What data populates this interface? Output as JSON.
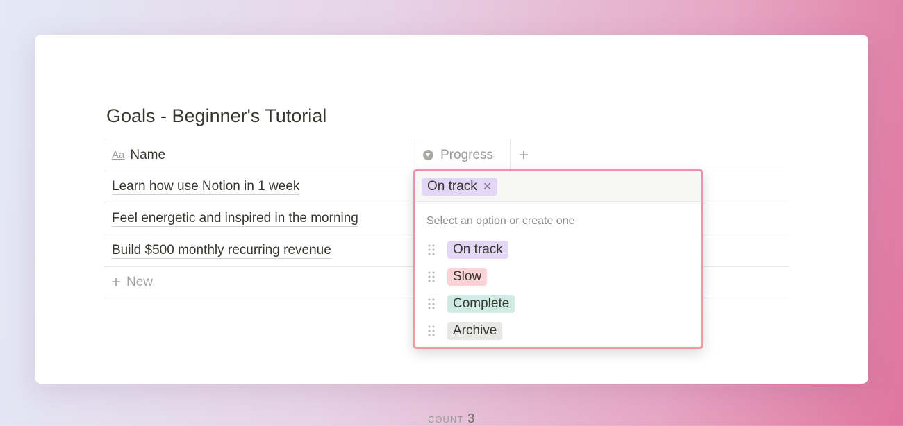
{
  "page": {
    "title": "Goals - Beginner's Tutorial"
  },
  "table": {
    "columns": [
      {
        "label": "Name",
        "icon": "text-icon",
        "icon_text": "Aa"
      },
      {
        "label": "Progress",
        "icon": "select-icon"
      }
    ],
    "add_column": "+",
    "rows": [
      {
        "name": "Learn how use Notion in 1 week"
      },
      {
        "name": "Feel energetic and inspired in the morning"
      },
      {
        "name": "Build $500 monthly recurring revenue"
      }
    ],
    "new_label": "New",
    "count_label": "COUNT",
    "count_value": "3"
  },
  "dropdown": {
    "selected": {
      "label": "On track",
      "color": "#e3d7f5"
    },
    "hint": "Select an option or create one",
    "options": [
      {
        "label": "On track",
        "color": "#e3d7f5"
      },
      {
        "label": "Slow",
        "color": "#fbd3d6"
      },
      {
        "label": "Complete",
        "color": "#d0ebe4"
      },
      {
        "label": "Archive",
        "color": "#e8e8e6"
      }
    ]
  }
}
